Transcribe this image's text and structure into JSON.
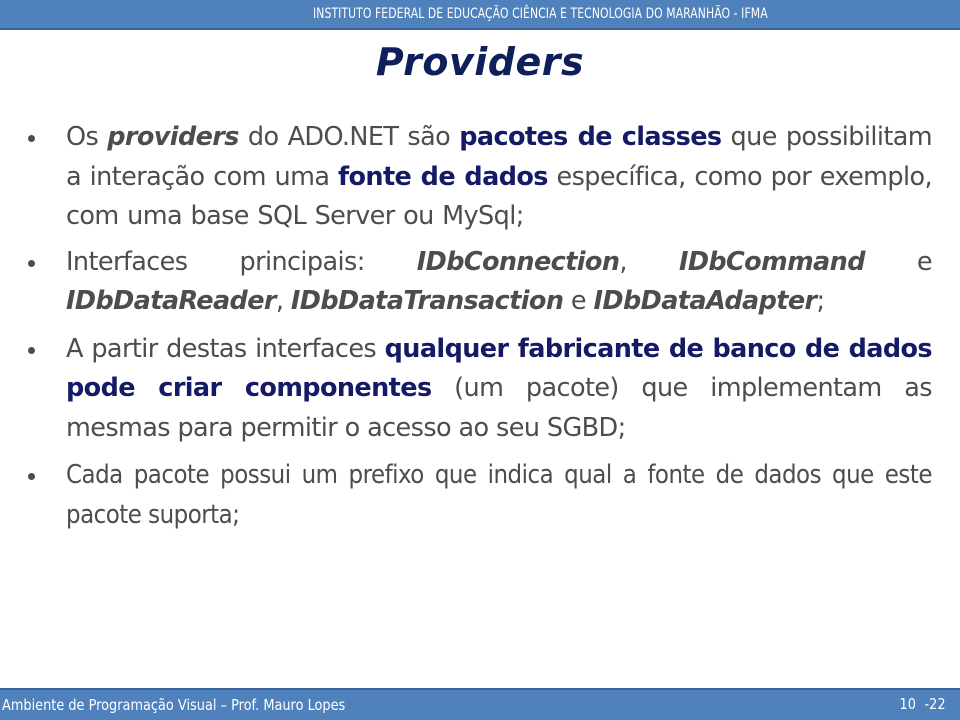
{
  "header": {
    "institution": "INSTITUTO FEDERAL DE EDUCAÇÃO CIÊNCIA E TECNOLOGIA DO MARANHÃO - IFMA"
  },
  "slide": {
    "title": "Providers",
    "bullets": [
      {
        "segments": [
          {
            "text": "Os ",
            "style": "normal"
          },
          {
            "text": "providers",
            "style": "italic-bold"
          },
          {
            "text": " do ADO.NET são ",
            "style": "normal"
          },
          {
            "text": "pacotes de classes",
            "style": "highlight"
          },
          {
            "text": " que possibilitam a interação com uma ",
            "style": "normal"
          },
          {
            "text": "fonte de dados",
            "style": "highlight"
          },
          {
            "text": " específica, como por exemplo, com uma base SQL Server ou MySql;",
            "style": "normal"
          }
        ]
      },
      {
        "segments": [
          {
            "text": "Interfaces principais: ",
            "style": "normal"
          },
          {
            "text": "IDbConnection",
            "style": "italic-bold"
          },
          {
            "text": ", ",
            "style": "normal"
          },
          {
            "text": "IDbCommand",
            "style": "italic-bold"
          },
          {
            "text": " e ",
            "style": "normal"
          },
          {
            "text": "IDbDataReader",
            "style": "italic-bold"
          },
          {
            "text": ", ",
            "style": "normal"
          },
          {
            "text": "IDbDataTransaction",
            "style": "italic-bold"
          },
          {
            "text": " e ",
            "style": "normal"
          },
          {
            "text": "IDbDataAdapter",
            "style": "italic-bold"
          },
          {
            "text": ";",
            "style": "normal"
          }
        ]
      },
      {
        "segments": [
          {
            "text": "A partir destas interfaces ",
            "style": "normal"
          },
          {
            "text": "qualquer fabricante de banco de dados pode criar componentes",
            "style": "highlight"
          },
          {
            "text": " (um pacote) que implementam as mesmas para permitir o acesso ao seu SGBD;",
            "style": "normal"
          }
        ]
      },
      {
        "segments": [
          {
            "text": "Cada pacote possui um prefixo que indica qual a fonte de dados que este pacote suporta;",
            "style": "normal"
          }
        ]
      }
    ]
  },
  "footer": {
    "course": "Ambiente de Programação Visual – Prof. Mauro Lopes",
    "slide_number": "10",
    "total": "-22"
  },
  "colors": {
    "bar": "#4f81bd",
    "title": "#0e1f5b",
    "highlight": "#141a66",
    "body_text": "#4d4d4d"
  }
}
